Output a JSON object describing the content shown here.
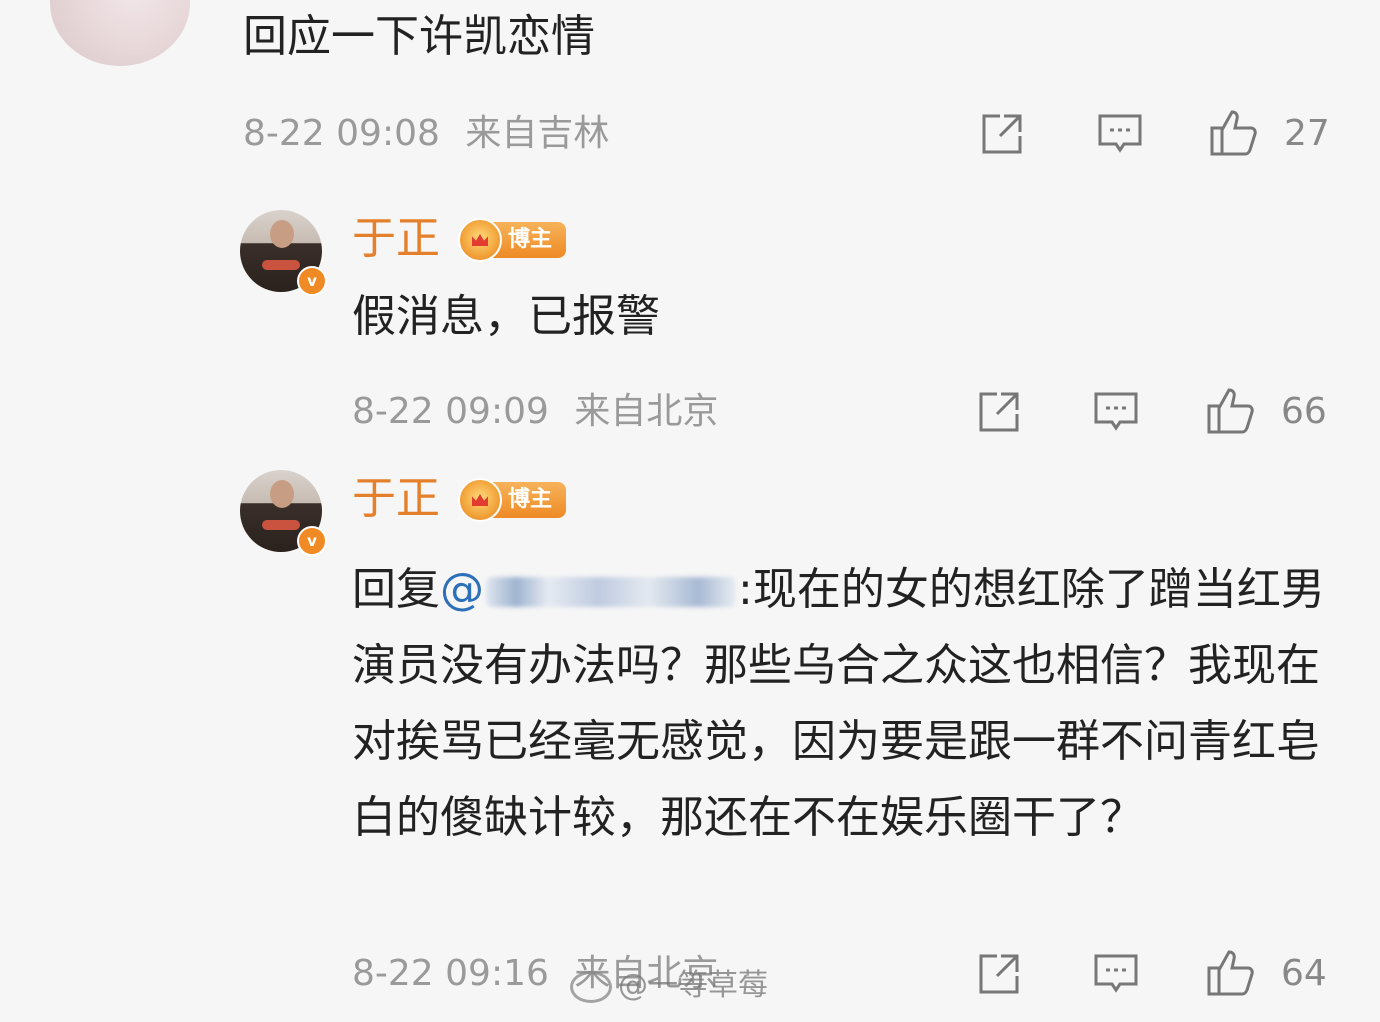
{
  "comment_top": {
    "text": "回应一下许凯恋情",
    "date": "8-22 09:08",
    "source": "来自吉林",
    "likes": "27"
  },
  "reply1": {
    "author": "于正",
    "badge": "博主",
    "text": "假消息，已报警",
    "date": "8-22 09:09",
    "source": "来自北京",
    "likes": "66"
  },
  "reply2": {
    "author": "于正",
    "badge": "博主",
    "prefix": "回复",
    "mention_start": "@",
    "mention_end": ":",
    "text": "现在的女的想红除了蹭当红男演员没有办法吗？那些乌合之众这也相信？我现在对挨骂已经毫无感觉，因为要是跟一群不问青红皂白的傻缺计较，那还在不在娱乐圈干了？",
    "date": "8-22 09:16",
    "source": "来自北京",
    "likes": "64"
  },
  "watermark": "@一等草莓",
  "colors": {
    "name": "#e4802c",
    "meta": "#9a9a9a",
    "mention": "#2d6fb8",
    "background": "#f6f6f6"
  }
}
